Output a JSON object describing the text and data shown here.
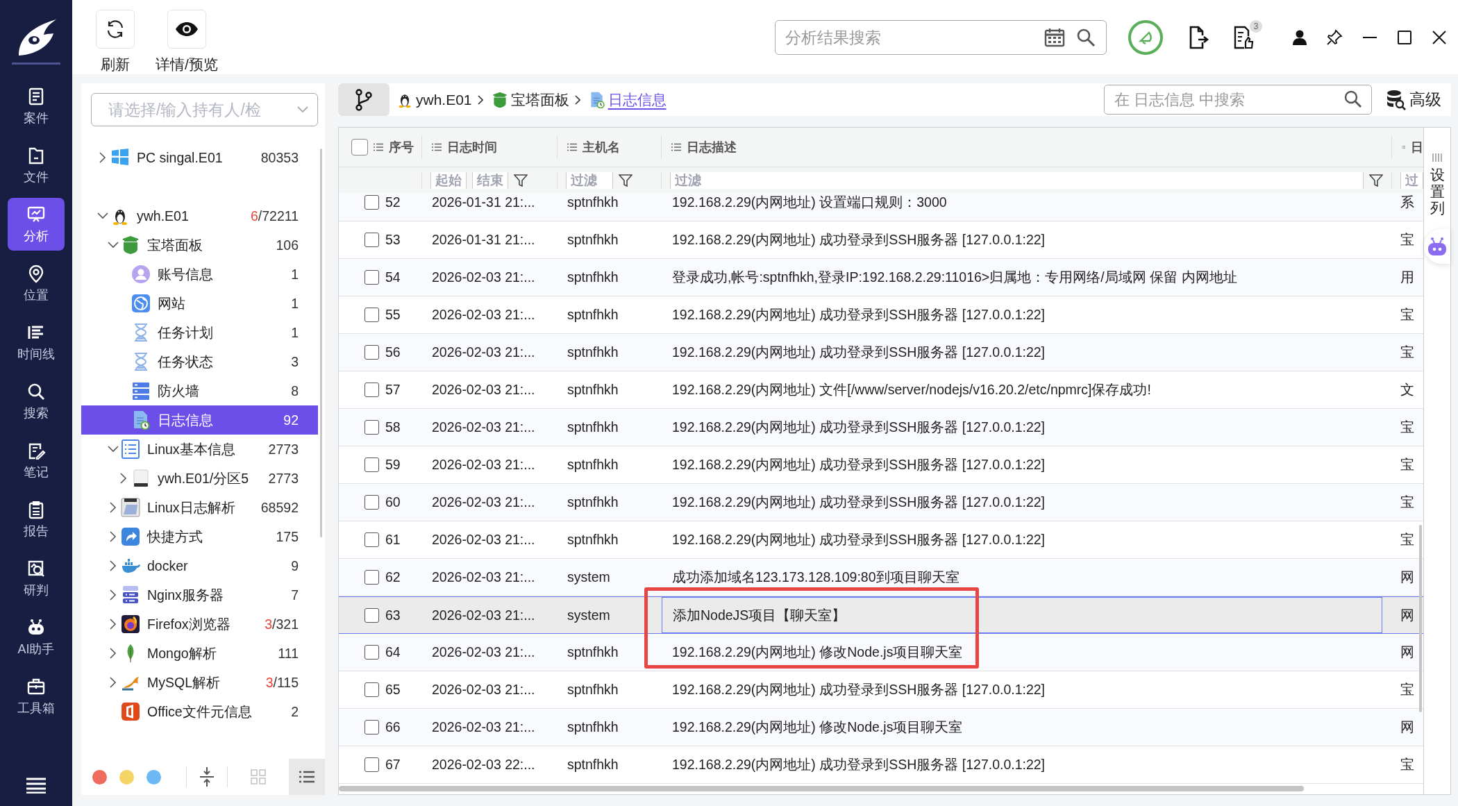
{
  "nav": {
    "items": [
      {
        "label": "案件",
        "selected": false
      },
      {
        "label": "文件",
        "selected": false
      },
      {
        "label": "分析",
        "selected": true
      },
      {
        "label": "位置",
        "selected": false
      },
      {
        "label": "时间线",
        "selected": false
      },
      {
        "label": "搜索",
        "selected": false
      },
      {
        "label": "笔记",
        "selected": false
      },
      {
        "label": "报告",
        "selected": false
      },
      {
        "label": "研判",
        "selected": false
      },
      {
        "label": "AI助手",
        "selected": false
      },
      {
        "label": "工具箱",
        "selected": false
      }
    ]
  },
  "toolbar": {
    "tools": [
      {
        "label": "刷新"
      },
      {
        "label": "详情/预览"
      }
    ],
    "search": {
      "placeholder": "分析结果搜索"
    },
    "badge": "3"
  },
  "tree": {
    "search": {
      "placeholder": "请选择/输入持有人/检"
    },
    "nodes": [
      {
        "label": "PC  singal.E01",
        "count": "80353",
        "expanded": false,
        "selected": false
      },
      {
        "label": "ywh.E01",
        "alert": "6",
        "count": "/72211",
        "expanded": true,
        "selected": false,
        "children": [
          {
            "label": "宝塔面板",
            "count": "106",
            "expanded": true,
            "selected": false,
            "children": [
              {
                "label": "账号信息",
                "count": "1",
                "selected": false
              },
              {
                "label": "网站",
                "count": "1",
                "selected": false
              },
              {
                "label": "任务计划",
                "count": "1",
                "selected": false
              },
              {
                "label": "任务状态",
                "count": "3",
                "selected": false
              },
              {
                "label": "防火墙",
                "count": "8",
                "selected": false
              },
              {
                "label": "日志信息",
                "count": "92",
                "selected": true
              }
            ]
          },
          {
            "label": "Linux基本信息",
            "count": "2773",
            "expanded": true,
            "selected": false,
            "children": [
              {
                "label": "ywh.E01/分区5",
                "count": "2773",
                "expanded": false,
                "selected": false
              }
            ]
          },
          {
            "label": "Linux日志解析",
            "count": "68592",
            "expanded": false,
            "selected": false
          },
          {
            "label": "快捷方式",
            "count": "175",
            "expanded": false,
            "selected": false
          },
          {
            "label": "docker",
            "count": "9",
            "expanded": false,
            "selected": false
          },
          {
            "label": "Nginx服务器",
            "count": "7",
            "expanded": false,
            "selected": false
          },
          {
            "label": "Firefox浏览器",
            "alert": "3",
            "count": "/321",
            "expanded": false,
            "selected": false
          },
          {
            "label": "Mongo解析",
            "count": "111",
            "expanded": false,
            "selected": false
          },
          {
            "label": "MySQL解析",
            "alert": "3",
            "count": "/115",
            "expanded": false,
            "selected": false
          },
          {
            "label": "Office文件元信息",
            "count": "2",
            "selected": false
          }
        ]
      }
    ],
    "colors": [
      {
        "color": "#ee6b5e"
      },
      {
        "color": "#f5d466"
      },
      {
        "color": "#6bb8f5"
      }
    ],
    "views": [
      {
        "selected": false
      },
      {
        "selected": true
      }
    ]
  },
  "main": {
    "breadcrumb": [
      {
        "label": "ywh.E01"
      },
      {
        "label": "宝塔面板"
      },
      {
        "label": "日志信息"
      }
    ],
    "search": {
      "placeholder": "在 日志信息 中搜索"
    },
    "advanced": "高级",
    "column_settings": "设置列",
    "header_checked": false,
    "columns": [
      {
        "label": "序号"
      },
      {
        "label": "日志时间",
        "filters": [
          "起始",
          "结束"
        ],
        "funnel": true
      },
      {
        "label": "主机名",
        "filters": [
          "过滤"
        ],
        "funnel": true
      },
      {
        "label": "日志描述",
        "filters": [
          "过滤"
        ],
        "funnel": true
      },
      {
        "label": "日",
        "filters": [
          "过"
        ],
        "funnel": false
      }
    ],
    "rows": [
      {
        "num": "52",
        "time": "2026-01-31 21:...",
        "host": "sptnfhkh",
        "desc": "192.168.2.29(内网地址) 设置端口规则：3000",
        "column_5": "系",
        "checked": false,
        "selected": false
      },
      {
        "num": "53",
        "time": "2026-01-31 21:...",
        "host": "sptnfhkh",
        "desc": "192.168.2.29(内网地址) 成功登录到SSH服务器 [127.0.0.1:22]",
        "column_5": "宝",
        "checked": false,
        "selected": false
      },
      {
        "num": "54",
        "time": "2026-02-03 21:...",
        "host": "sptnfhkh",
        "desc": "登录成功,帐号:sptnfhkh,登录IP:192.168.2.29:11016>归属地：专用网络/局域网 保留 内网地址",
        "column_5": "用",
        "checked": false,
        "selected": false
      },
      {
        "num": "55",
        "time": "2026-02-03 21:...",
        "host": "sptnfhkh",
        "desc": "192.168.2.29(内网地址) 成功登录到SSH服务器 [127.0.0.1:22]",
        "column_5": "宝",
        "checked": false,
        "selected": false
      },
      {
        "num": "56",
        "time": "2026-02-03 21:...",
        "host": "sptnfhkh",
        "desc": "192.168.2.29(内网地址) 成功登录到SSH服务器 [127.0.0.1:22]",
        "column_5": "宝",
        "checked": false,
        "selected": false
      },
      {
        "num": "57",
        "time": "2026-02-03 21:...",
        "host": "sptnfhkh",
        "desc": "192.168.2.29(内网地址) 文件[/www/server/nodejs/v16.20.2/etc/npmrc]保存成功!",
        "column_5": "文",
        "checked": false,
        "selected": false
      },
      {
        "num": "58",
        "time": "2026-02-03 21:...",
        "host": "sptnfhkh",
        "desc": "192.168.2.29(内网地址) 成功登录到SSH服务器 [127.0.0.1:22]",
        "column_5": "宝",
        "checked": false,
        "selected": false
      },
      {
        "num": "59",
        "time": "2026-02-03 21:...",
        "host": "sptnfhkh",
        "desc": "192.168.2.29(内网地址) 成功登录到SSH服务器 [127.0.0.1:22]",
        "column_5": "宝",
        "checked": false,
        "selected": false
      },
      {
        "num": "60",
        "time": "2026-02-03 21:...",
        "host": "sptnfhkh",
        "desc": "192.168.2.29(内网地址) 成功登录到SSH服务器 [127.0.0.1:22]",
        "column_5": "宝",
        "checked": false,
        "selected": false
      },
      {
        "num": "61",
        "time": "2026-02-03 21:...",
        "host": "sptnfhkh",
        "desc": "192.168.2.29(内网地址) 成功登录到SSH服务器 [127.0.0.1:22]",
        "column_5": "宝",
        "checked": false,
        "selected": false
      },
      {
        "num": "62",
        "time": "2026-02-03 21:...",
        "host": "system",
        "desc": "成功添加域名123.173.128.109:80到项目聊天室",
        "column_5": "网",
        "checked": false,
        "selected": false
      },
      {
        "num": "63",
        "time": "2026-02-03 21:...",
        "host": "system",
        "desc": "添加NodeJS项目【聊天室】",
        "column_5": "网",
        "checked": false,
        "selected": true
      },
      {
        "num": "64",
        "time": "2026-02-03 21:...",
        "host": "sptnfhkh",
        "desc": "192.168.2.29(内网地址) 修改Node.js项目聊天室",
        "column_5": "网",
        "checked": false,
        "selected": false
      },
      {
        "num": "65",
        "time": "2026-02-03 21:...",
        "host": "sptnfhkh",
        "desc": "192.168.2.29(内网地址) 成功登录到SSH服务器 [127.0.0.1:22]",
        "column_5": "宝",
        "checked": false,
        "selected": false
      },
      {
        "num": "66",
        "time": "2026-02-03 21:...",
        "host": "sptnfhkh",
        "desc": "192.168.2.29(内网地址) 修改Node.js项目聊天室",
        "column_5": "网",
        "checked": false,
        "selected": false
      },
      {
        "num": "67",
        "time": "2026-02-03 22:...",
        "host": "sptnfhkh",
        "desc": "192.168.2.29(内网地址) 成功登录到SSH服务器 [127.0.0.1:22]",
        "column_5": "宝",
        "checked": false,
        "selected": false
      }
    ]
  }
}
